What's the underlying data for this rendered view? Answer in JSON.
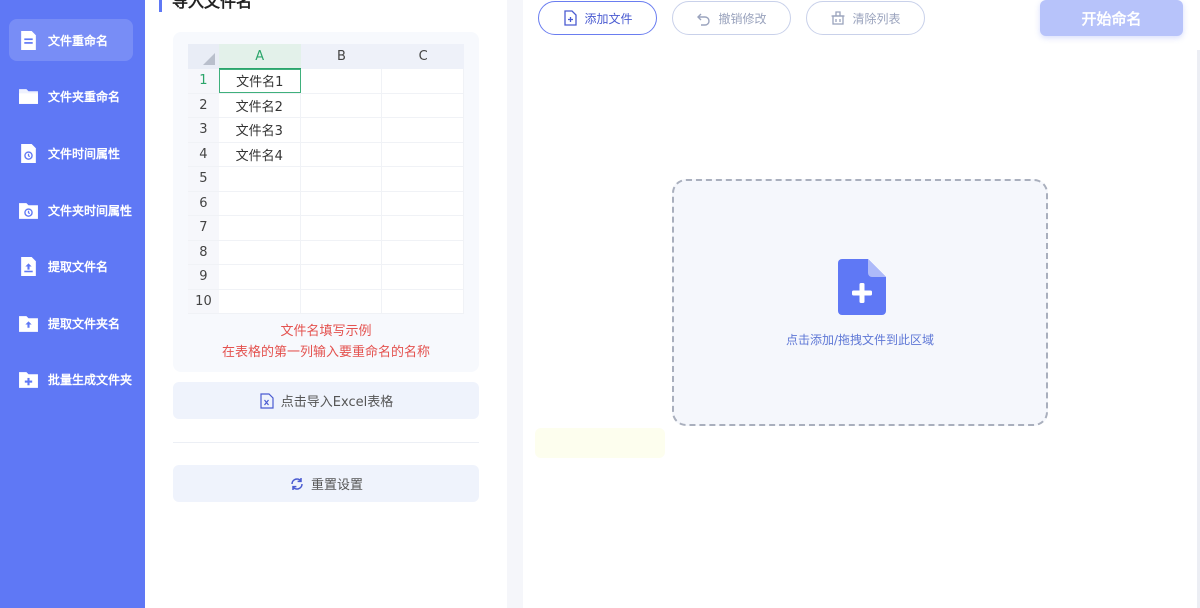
{
  "sidebar": {
    "items": [
      {
        "label": "文件重命名",
        "icon": "document-icon",
        "active": true
      },
      {
        "label": "文件夹重命名",
        "icon": "folder-icon",
        "active": false
      },
      {
        "label": "文件时间属性",
        "icon": "file-clock-icon",
        "active": false
      },
      {
        "label": "文件夹时间属性",
        "icon": "folder-clock-icon",
        "active": false
      },
      {
        "label": "提取文件名",
        "icon": "file-extract-icon",
        "active": false
      },
      {
        "label": "提取文件夹名",
        "icon": "folder-extract-icon",
        "active": false
      },
      {
        "label": "批量生成文件夹",
        "icon": "folder-add-icon",
        "active": false
      }
    ]
  },
  "left_panel": {
    "title": "导入文件名",
    "sheet": {
      "columns": [
        "A",
        "B",
        "C"
      ],
      "rows": [
        {
          "num": "1",
          "cells": [
            "文件名1",
            "",
            ""
          ]
        },
        {
          "num": "2",
          "cells": [
            "文件名2",
            "",
            ""
          ]
        },
        {
          "num": "3",
          "cells": [
            "文件名3",
            "",
            ""
          ]
        },
        {
          "num": "4",
          "cells": [
            "文件名4",
            "",
            ""
          ]
        },
        {
          "num": "5",
          "cells": [
            "",
            "",
            ""
          ]
        },
        {
          "num": "6",
          "cells": [
            "",
            "",
            ""
          ]
        },
        {
          "num": "7",
          "cells": [
            "",
            "",
            ""
          ]
        },
        {
          "num": "8",
          "cells": [
            "",
            "",
            ""
          ]
        },
        {
          "num": "9",
          "cells": [
            "",
            "",
            ""
          ]
        },
        {
          "num": "10",
          "cells": [
            "",
            "",
            ""
          ]
        }
      ],
      "selected_column": "A",
      "selected_row": "1"
    },
    "example_title": "文件名填写示例",
    "example_desc": "在表格的第一列输入要重命名的名称",
    "import_excel_label": "点击导入Excel表格",
    "reset_label": "重置设置"
  },
  "toolbar": {
    "add_file_label": "添加文件",
    "undo_label": "撤销修改",
    "clear_list_label": "清除列表",
    "start_label": "开始命名"
  },
  "drop_zone": {
    "text": "点击添加/拖拽文件到此区域"
  },
  "colors": {
    "sidebar": "#5f78f5",
    "accent": "#5f78f5",
    "warning_text": "#e4524f",
    "spreadsheet_select": "#2aa56a"
  }
}
